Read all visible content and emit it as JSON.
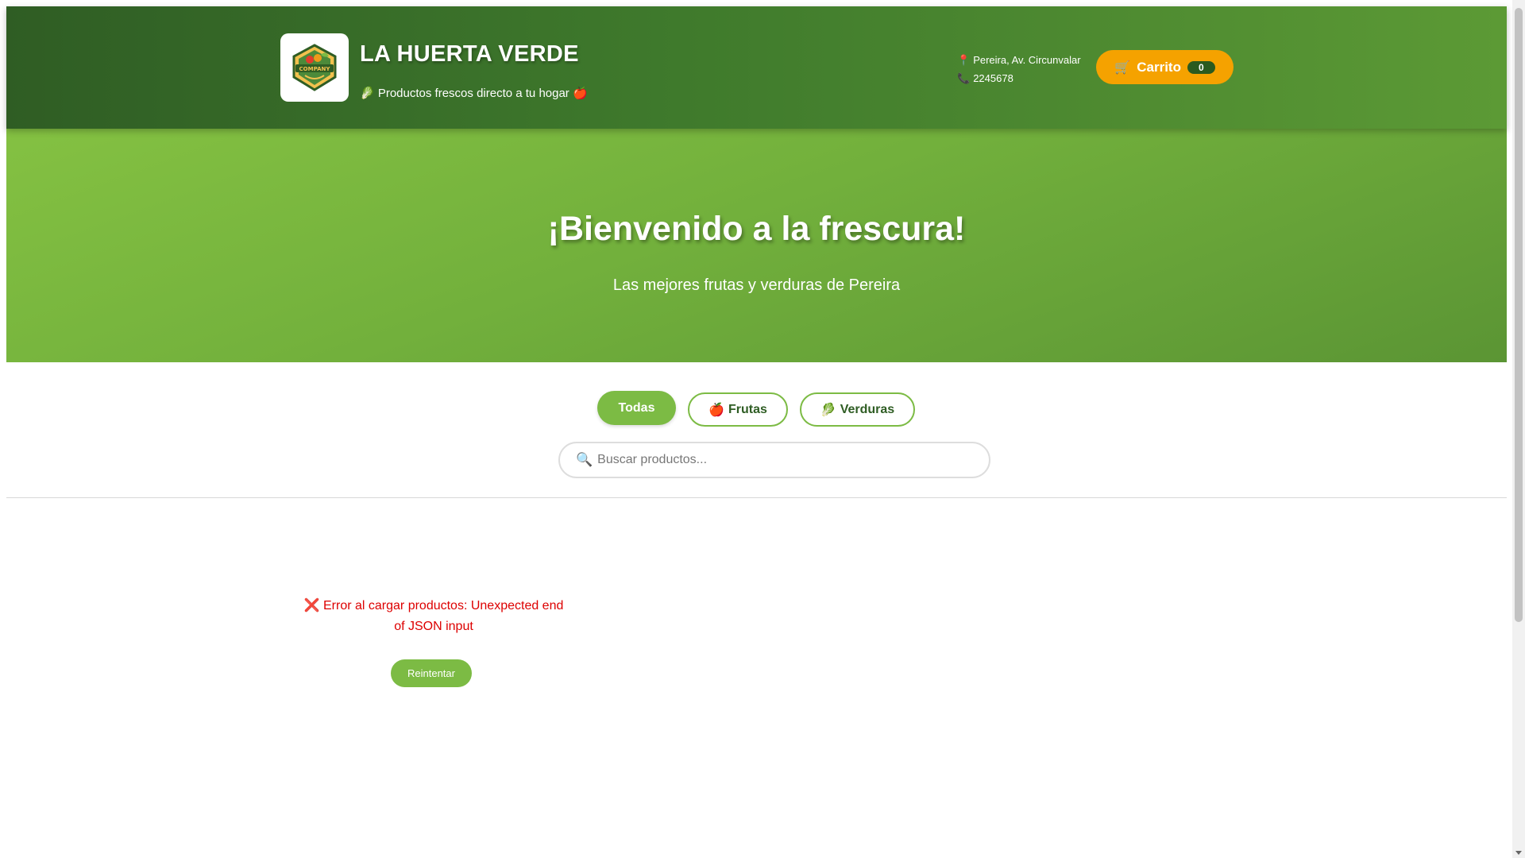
{
  "header": {
    "brand_title": "LA HUERTA VERDE",
    "tagline": "🥬 Productos frescos directo a tu hogar 🍎",
    "logo_icon": "company-badge-logo",
    "address": "Pereira, Av. Circunvalar",
    "phone": "2245678",
    "cart": {
      "label": "Carrito",
      "count": "0",
      "icon": "🛒"
    }
  },
  "hero": {
    "title": "¡Bienvenido a la frescura!",
    "subtitle": "Las mejores frutas y verduras de Pereira"
  },
  "filters": {
    "tabs": [
      {
        "label": "Todas",
        "emoji": "",
        "active": true
      },
      {
        "label": "Frutas",
        "emoji": "🍎",
        "active": false
      },
      {
        "label": "Verduras",
        "emoji": "🥬",
        "active": false
      }
    ]
  },
  "search": {
    "placeholder": "Buscar productos...",
    "value": ""
  },
  "error": {
    "message": "❌ Error al cargar productos: Unexpected end of JSON input",
    "retry_label": "Reintentar"
  },
  "colors": {
    "header_dark": "#2f5d24",
    "hero_green": "#7cbb44",
    "cart_orange": "#f5a200",
    "error_red": "#dd0000"
  }
}
